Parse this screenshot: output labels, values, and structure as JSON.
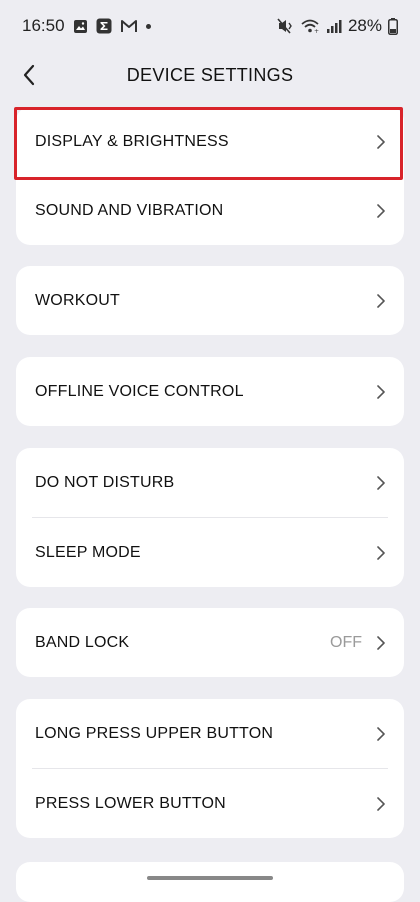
{
  "status_bar": {
    "time": "16:50",
    "battery": "28%",
    "left_icons": [
      "gallery-icon",
      "sigma-app-icon",
      "gmail-icon",
      "notification-dot"
    ],
    "right_icons": [
      "mute-vibrate-icon",
      "wifi-icon",
      "signal-icon",
      "battery-icon"
    ]
  },
  "header": {
    "title": "DEVICE SETTINGS",
    "back_icon": "chevron-left-icon"
  },
  "groups": [
    {
      "items": [
        {
          "label": "DISPLAY & BRIGHTNESS"
        },
        {
          "label": "SOUND AND VIBRATION"
        }
      ]
    },
    {
      "items": [
        {
          "label": "WORKOUT"
        }
      ]
    },
    {
      "items": [
        {
          "label": "OFFLINE VOICE CONTROL"
        }
      ]
    },
    {
      "items": [
        {
          "label": "DO NOT DISTURB"
        },
        {
          "label": "SLEEP MODE"
        }
      ]
    },
    {
      "items": [
        {
          "label": "BAND LOCK",
          "value": "OFF"
        }
      ]
    },
    {
      "items": [
        {
          "label": "LONG PRESS UPPER BUTTON"
        },
        {
          "label": "PRESS LOWER BUTTON"
        }
      ]
    }
  ],
  "colors": {
    "background": "#EDEDF2",
    "card": "#FFFFFF",
    "highlight": "#D8232A",
    "value_text": "#9A9A9A"
  }
}
